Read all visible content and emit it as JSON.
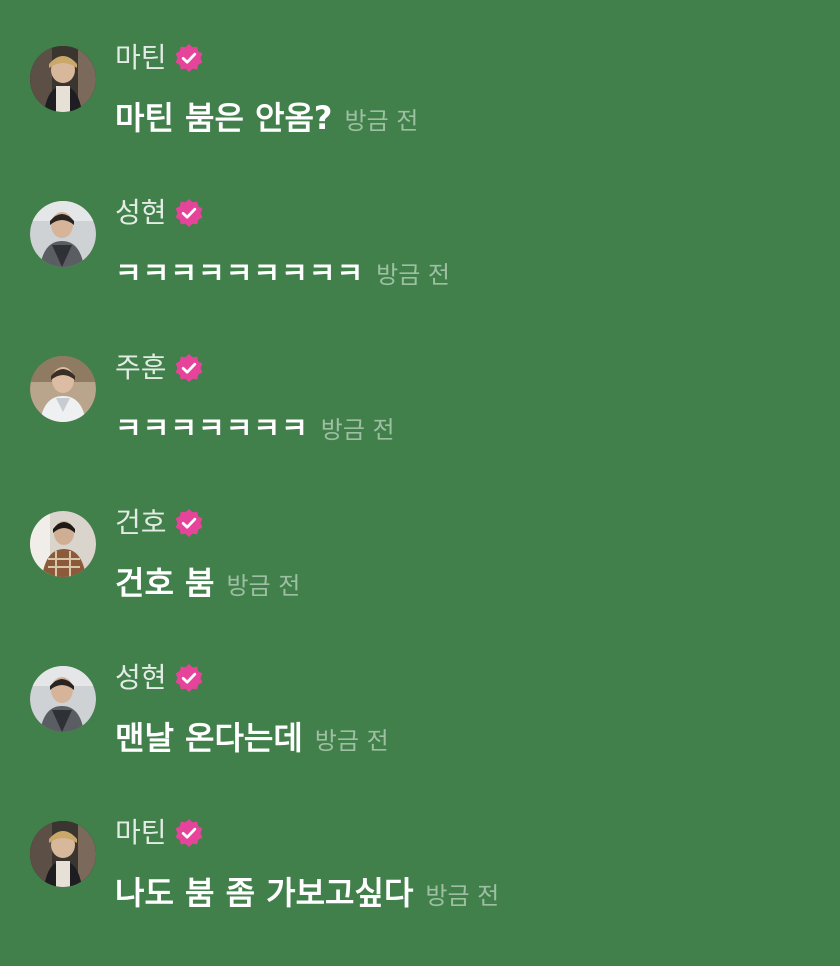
{
  "theme": {
    "background": "#417f4b",
    "name_color": "#e3ece4",
    "text_color": "#ffffff",
    "time_color": "#9dbfa2",
    "badge_color": "#e6449b"
  },
  "messages": [
    {
      "author": "마틴",
      "verified_icon": "verified-badge-icon",
      "text": "마틴 붐은 안옴?",
      "time": "방금 전",
      "avatar": "avatar-martin"
    },
    {
      "author": "성현",
      "verified_icon": "verified-badge-icon",
      "text": "ㅋㅋㅋㅋㅋㅋㅋㅋㅋ",
      "time": "방금 전",
      "avatar": "avatar-seonghyeon"
    },
    {
      "author": "주훈",
      "verified_icon": "verified-badge-icon",
      "text": "ㅋㅋㅋㅋㅋㅋㅋ",
      "time": "방금 전",
      "avatar": "avatar-juhun"
    },
    {
      "author": "건호",
      "verified_icon": "verified-badge-icon",
      "text": "건호 붐",
      "time": "방금 전",
      "avatar": "avatar-geonho"
    },
    {
      "author": "성현",
      "verified_icon": "verified-badge-icon",
      "text": "맨날 온다는데",
      "time": "방금 전",
      "avatar": "avatar-seonghyeon"
    },
    {
      "author": "마틴",
      "verified_icon": "verified-badge-icon",
      "text": "나도 붐 좀 가보고싶다",
      "time": "방금 전",
      "avatar": "avatar-martin"
    }
  ]
}
